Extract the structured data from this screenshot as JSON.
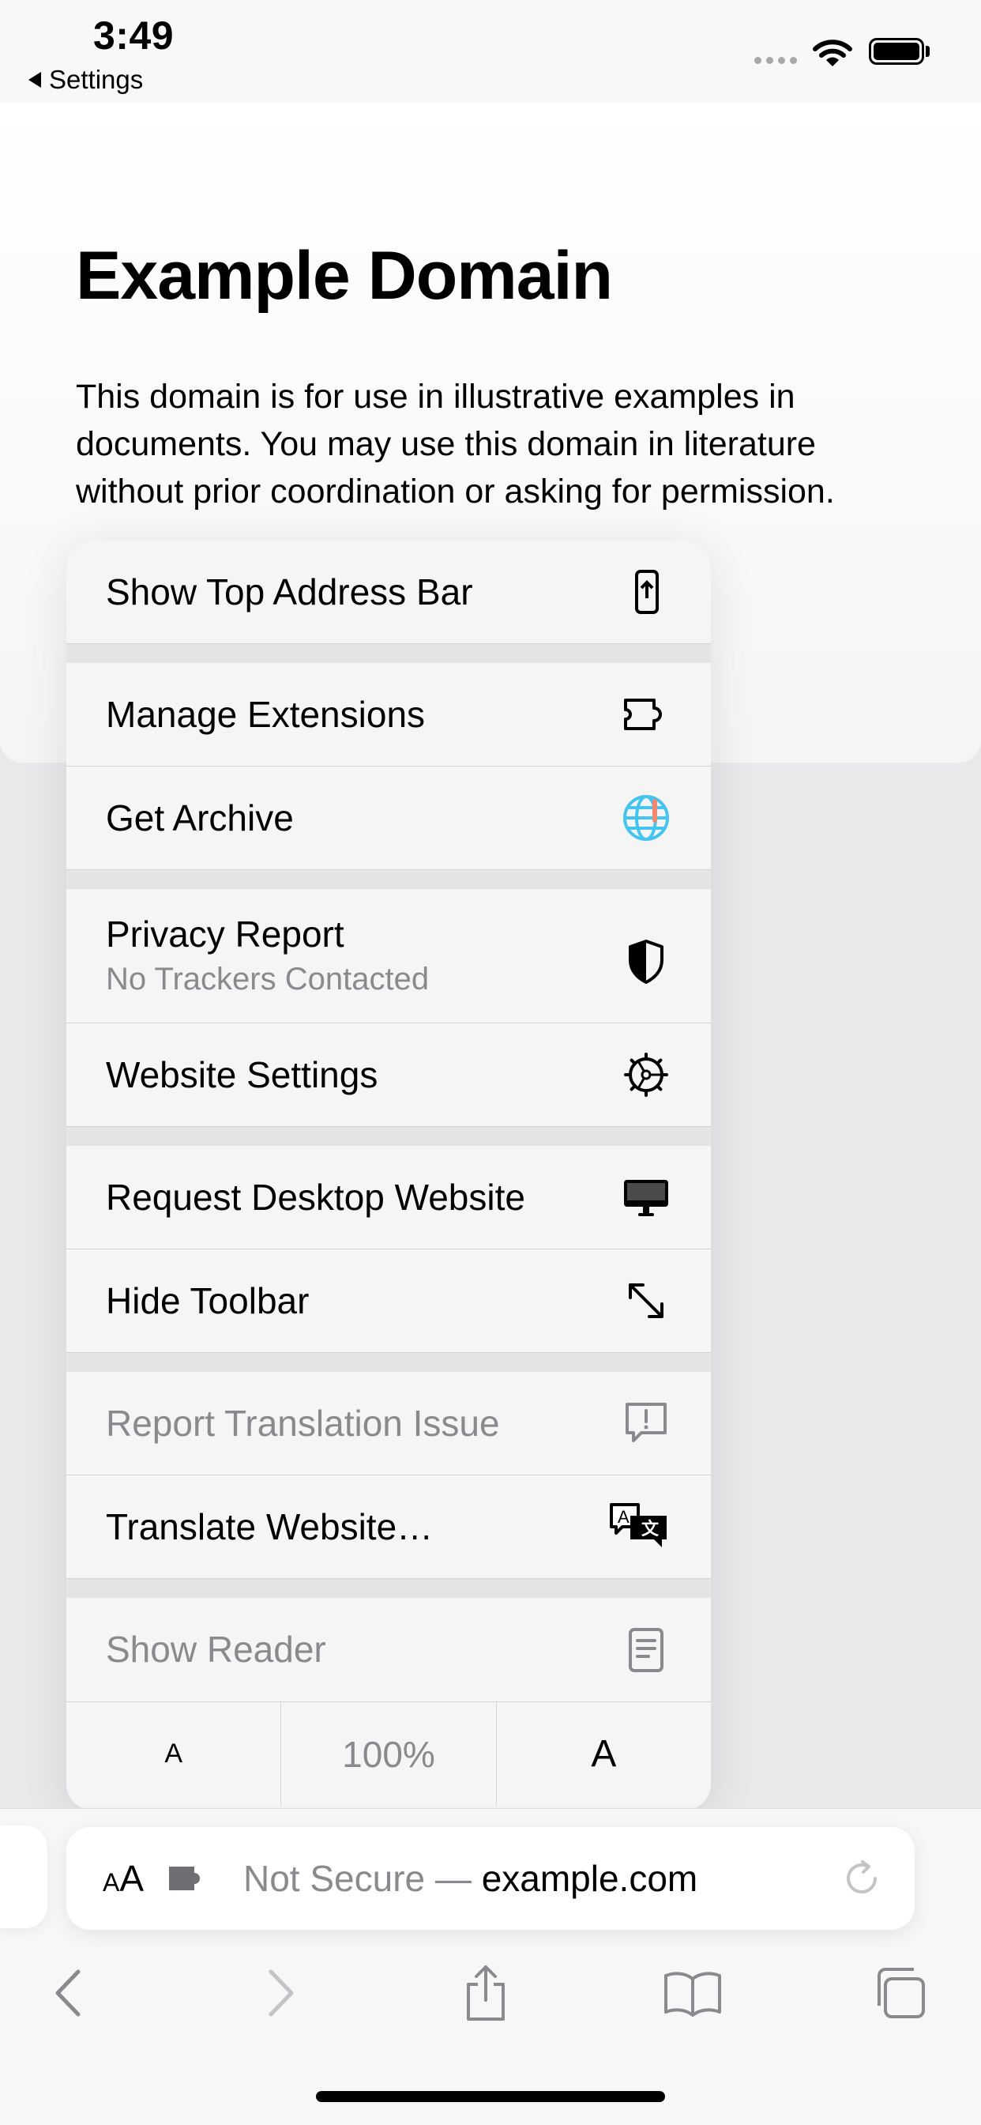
{
  "status_bar": {
    "time": "3:49",
    "back_label": "Settings"
  },
  "page": {
    "heading": "Example Domain",
    "paragraph": "This domain is for use in illustrative examples in documents. You may use this domain in literature without prior coordination or asking for permission."
  },
  "menu": {
    "show_top_address_bar": "Show Top Address Bar",
    "manage_extensions": "Manage Extensions",
    "get_archive": "Get Archive",
    "privacy_report": "Privacy Report",
    "privacy_report_sub": "No Trackers Contacted",
    "website_settings": "Website Settings",
    "request_desktop_website": "Request Desktop Website",
    "hide_toolbar": "Hide Toolbar",
    "report_translation_issue": "Report Translation Issue",
    "translate_website": "Translate Website…",
    "show_reader": "Show Reader",
    "font_decrease": "A",
    "zoom_level": "100%",
    "font_increase": "A"
  },
  "address_bar": {
    "aa_small": "A",
    "aa_large": "A",
    "url_prefix": "Not Secure — ",
    "domain": "example.com"
  }
}
